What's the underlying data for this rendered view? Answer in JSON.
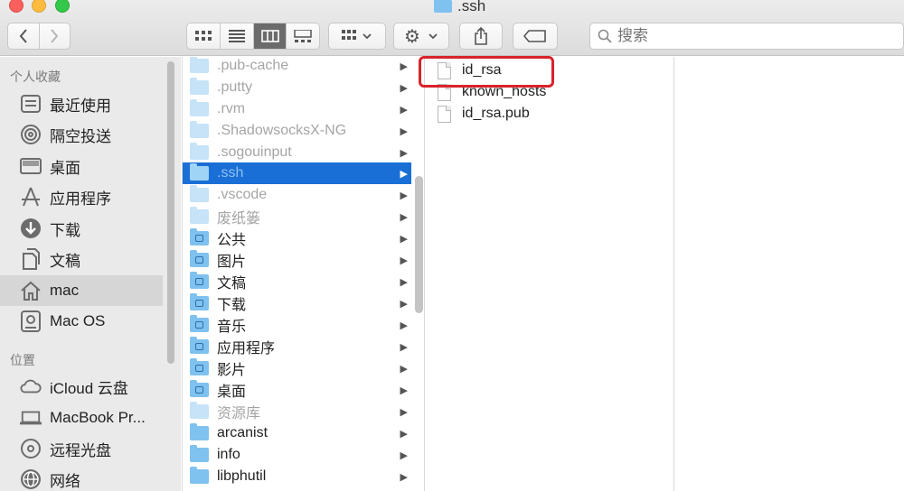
{
  "window": {
    "title": ".ssh"
  },
  "toolbar": {
    "back_icon": "chevron-left-icon",
    "forward_icon": "chevron-right-icon",
    "view_modes": [
      "icon-view",
      "list-view",
      "column-view",
      "gallery-view"
    ],
    "active_view": "column-view",
    "search_placeholder": "搜索"
  },
  "sidebar": {
    "favorites_header": "个人收藏",
    "favorites": [
      {
        "label": "最近使用",
        "icon": "recents-icon"
      },
      {
        "label": "隔空投送",
        "icon": "airdrop-icon"
      },
      {
        "label": "桌面",
        "icon": "desktop-icon"
      },
      {
        "label": "应用程序",
        "icon": "applications-icon"
      },
      {
        "label": "下载",
        "icon": "downloads-icon"
      },
      {
        "label": "文稿",
        "icon": "documents-icon"
      },
      {
        "label": "mac",
        "icon": "home-icon"
      },
      {
        "label": "Mac OS",
        "icon": "disk-icon"
      }
    ],
    "selected": "mac",
    "locations_header": "位置",
    "locations": [
      {
        "label": "iCloud 云盘",
        "icon": "icloud-icon"
      },
      {
        "label": "MacBook Pr...",
        "icon": "laptop-icon"
      },
      {
        "label": "远程光盘",
        "icon": "optical-disc-icon"
      },
      {
        "label": "网络",
        "icon": "network-icon"
      }
    ]
  },
  "column1": {
    "items": [
      {
        "label": ".pub-cache",
        "hidden": true
      },
      {
        "label": ".putty",
        "hidden": true
      },
      {
        "label": ".rvm",
        "hidden": true
      },
      {
        "label": ".ShadowsocksX-NG",
        "hidden": true
      },
      {
        "label": ".sogouinput",
        "hidden": true
      },
      {
        "label": ".ssh",
        "hidden": true,
        "selected": true
      },
      {
        "label": ".vscode",
        "hidden": true
      },
      {
        "label": "废纸篓",
        "hidden": true
      },
      {
        "label": "公共",
        "hidden": false
      },
      {
        "label": "图片",
        "hidden": false
      },
      {
        "label": "文稿",
        "hidden": false
      },
      {
        "label": "下载",
        "hidden": false
      },
      {
        "label": "音乐",
        "hidden": false
      },
      {
        "label": "应用程序",
        "hidden": false
      },
      {
        "label": "影片",
        "hidden": false
      },
      {
        "label": "桌面",
        "hidden": false
      },
      {
        "label": "资源库",
        "hidden": true
      },
      {
        "label": "arcanist",
        "hidden": false
      },
      {
        "label": "info",
        "hidden": false
      },
      {
        "label": "libphutil",
        "hidden": false
      }
    ]
  },
  "column2": {
    "files": [
      "id_rsa",
      "known_hosts",
      "id_rsa.pub"
    ],
    "highlighted": "id_rsa"
  }
}
